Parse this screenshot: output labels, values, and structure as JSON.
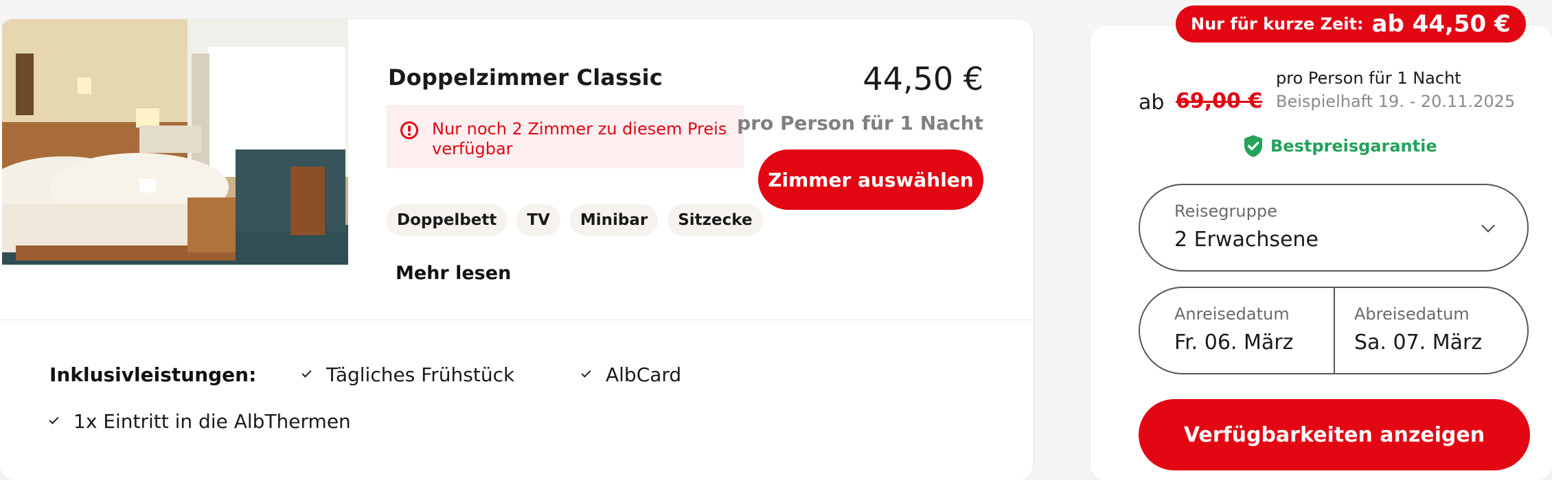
{
  "room": {
    "title": "Doppelzimmer Classic",
    "scarcity_note": "Nur noch 2 Zimmer zu diesem Preis verfügbar",
    "features": [
      "Doppelbett",
      "TV",
      "Minibar",
      "Sitzecke"
    ],
    "more_link": "Mehr lesen",
    "price": "44,50 €",
    "price_unit": "pro Person für 1 Nacht",
    "select_button": "Zimmer auswählen",
    "inclusions_label": "Inklusivleistungen:",
    "inclusions": [
      "Tägliches Frühstück",
      "AlbCard",
      "1x Eintritt in die AlbThermen"
    ]
  },
  "booking": {
    "promo_label": "Nur für kurze Zeit:",
    "promo_price": "ab 44,50 €",
    "ab_prefix": "ab",
    "old_price": "69,00 €",
    "per_person": "pro Person für 1 Nacht",
    "example": "Beispielhaft 19. - 20.11.2025",
    "guarantee": "Bestpreisgarantie",
    "group_label": "Reisegruppe",
    "group_value": "2 Erwachsene",
    "arrival_label": "Anreisedatum",
    "arrival_value": "Fr. 06. März",
    "departure_label": "Abreisedatum",
    "departure_value": "Sa. 07. März",
    "availability_button": "Verfügbarkeiten anzeigen"
  },
  "colors": {
    "accent": "#e30613",
    "success": "#21a35a",
    "scarcity_bg": "#fdeff0"
  },
  "icons": [
    "room-photo",
    "warning-circle-icon",
    "check-icon",
    "shield-check-icon",
    "chevron-down-icon"
  ]
}
